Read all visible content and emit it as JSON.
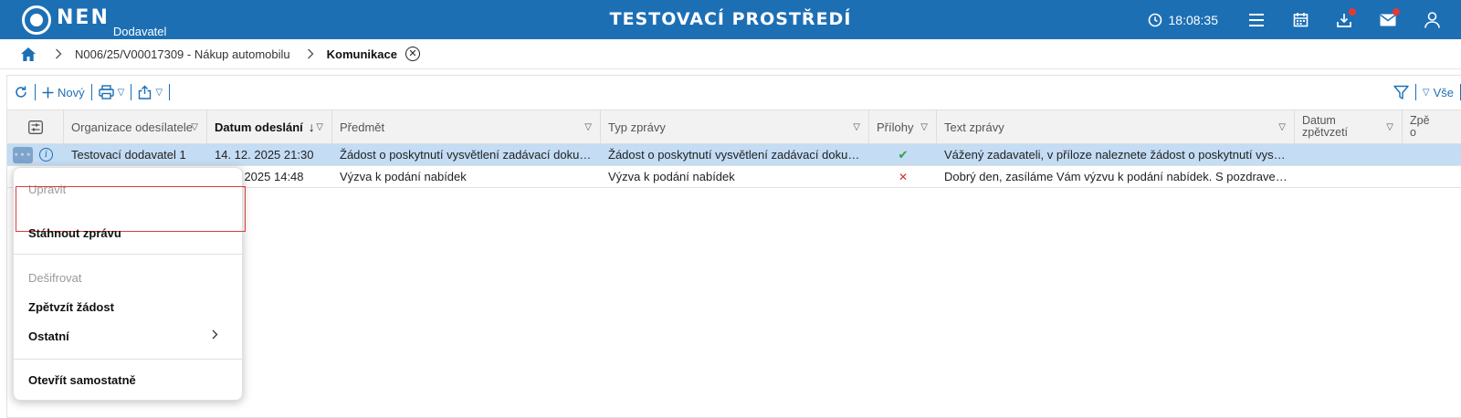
{
  "header": {
    "logo_text": "NEN",
    "logo_sub": "Dodavatel",
    "env_title": "TESTOVACÍ PROSTŘEDÍ",
    "clock": "18:08:35"
  },
  "breadcrumb": {
    "items": [
      "N006/25/V00017309 - Nákup automobilu",
      "Komunikace"
    ]
  },
  "toolbar": {
    "new_label": "Nový",
    "filter_all_label": "Vše"
  },
  "table": {
    "columns": [
      "Organizace odesílatele",
      "Datum odeslání",
      "Předmět",
      "Typ zprávy",
      "Přílohy",
      "Text zprávy",
      "Datum zpětvzetí",
      "Zpě o"
    ],
    "rows": [
      {
        "org": "Testovací dodavatel 1",
        "date": "14. 12. 2025 21:30",
        "subject": "Žádost o poskytnutí vysvětlení zadávací dokum...",
        "type": "Žádost o poskytnutí vysvětlení zadávací dokum...",
        "attachment": "✔",
        "text": "Vážený zadavateli, v příloze naleznete žádost o poskytnutí vysvět...",
        "withdrawn": "",
        "selected": true
      },
      {
        "org": "",
        "date": "2. 2025 14:48",
        "subject": "Výzva k podání nabídek",
        "type": "Výzva k podání nabídek",
        "attachment": "✕",
        "text": "Dobrý den, zasíláme Vám výzvu k podání nabídek. S pozdravem ...",
        "withdrawn": "",
        "selected": false
      }
    ]
  },
  "context_menu": {
    "items": [
      {
        "label": "Upravit",
        "disabled": true
      },
      {
        "label": "Stáhnout zprávu",
        "disabled": false,
        "highlighted": true
      },
      {
        "label": "Dešifrovat",
        "disabled": true
      },
      {
        "label": "Zpětvzít žádost",
        "disabled": false
      },
      {
        "label": "Ostatní",
        "disabled": false,
        "submenu": true
      },
      {
        "label": "Otevřít samostatně",
        "disabled": false
      }
    ]
  },
  "colors": {
    "primary": "#1d6fb4",
    "selected_row": "#c4dcf4",
    "check": "#2e9e44",
    "cross": "#d32f2f",
    "highlight_border": "#e03a3a",
    "badge": "#e53935"
  }
}
